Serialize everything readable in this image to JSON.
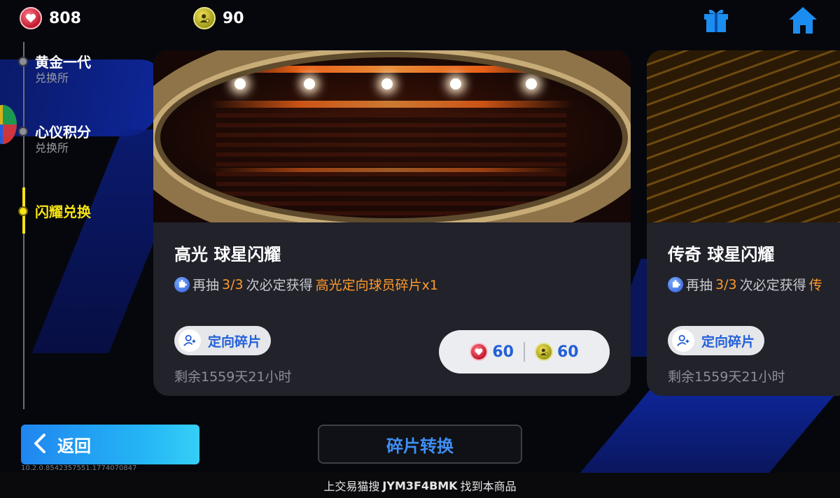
{
  "currencies": {
    "hearts": "808",
    "coins": "90"
  },
  "icons": {
    "heart": "heart-icon",
    "coin": "coin-icon",
    "gift": "gift-icon",
    "home": "home-icon",
    "puzzle": "puzzle-icon",
    "player": "player-icon",
    "back": "chevron-left-icon"
  },
  "sidebar": {
    "items": [
      {
        "title": "黄金一代",
        "sub": "兑换所"
      },
      {
        "title": "心仪积分",
        "sub": "兑换所"
      },
      {
        "title": "闪耀兑换",
        "sub": ""
      }
    ],
    "active_index": 2
  },
  "cards": [
    {
      "title": "高光 球星闪耀",
      "desc_prefix": "再抽",
      "desc_count": "3/3",
      "desc_mid": "次必定获得",
      "desc_reward": "高光定向球员碎片x1",
      "tag": "定向碎片",
      "remaining": "剩余1559天21小时",
      "price_hearts": "60",
      "price_coins": "60"
    },
    {
      "title": "传奇 球星闪耀",
      "desc_prefix": "再抽",
      "desc_count": "3/3",
      "desc_mid": "次必定获得",
      "desc_reward": "传",
      "tag": "定向碎片",
      "remaining": "剩余1559天21小时"
    }
  ],
  "buttons": {
    "back": "返回",
    "convert": "碎片转换"
  },
  "version": "10.2.0.8542357551.1774070847",
  "footer": {
    "prefix": "上交易猫搜",
    "code": "JYM3F4BMK",
    "suffix": "找到本商品"
  },
  "colors": {
    "accent_blue": "#2360d8",
    "highlight_orange": "#ff9a2a",
    "active_yellow": "#f5e313",
    "card_bg": "#21222a"
  }
}
